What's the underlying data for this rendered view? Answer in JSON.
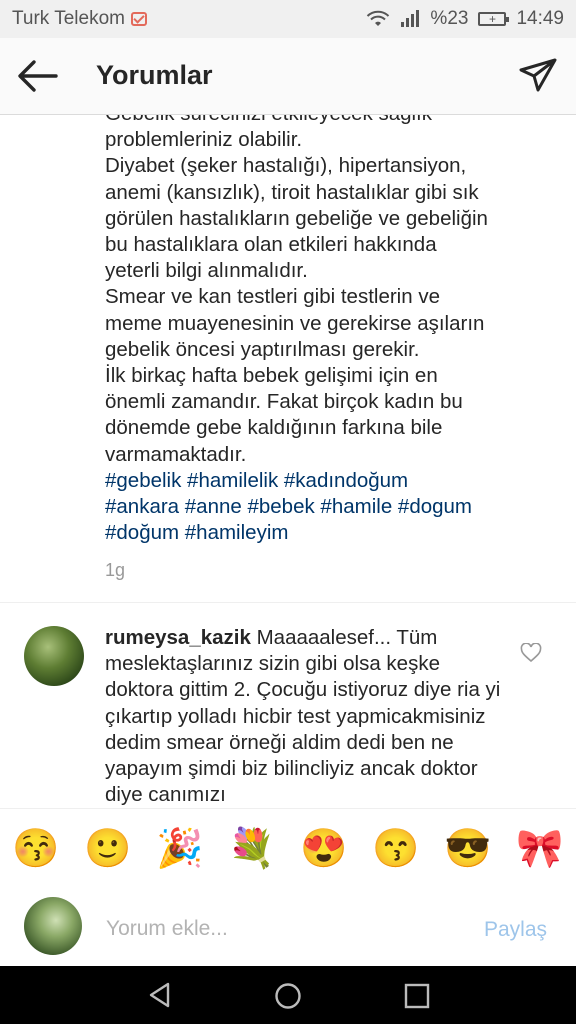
{
  "status_bar": {
    "carrier": "Turk Telekom",
    "signal_percent": "%23",
    "time": "14:49"
  },
  "header": {
    "title": "Yorumlar",
    "back_icon": "arrow-left-icon",
    "send_icon": "paper-plane-icon"
  },
  "caption": {
    "text": "Gebelik sürecinizi etkileyecek sağlık\nproblemleriniz olabilir.\nDiyabet (şeker hastalığı), hipertansiyon,\nanemi (kansızlık), tiroit hastalıklar gibi sık\ngörülen hastalıkların gebeliğe ve gebeliğin\nbu hastalıklara olan etkileri hakkında\nyeterli bilgi alınmalıdır.\nSmear ve kan testleri gibi testlerin ve\nmeme muayenesinin ve gerekirse aşıların\ngebelik öncesi yaptırılması gerekir.\nİlk birkaç hafta bebek gelişimi için en\nönemli zamandır. Fakat birçok kadın bu\ndönemde gebe kaldığının farkına bile\nvarmamaktadır.",
    "hashtags": "#gebelik #hamilelik #kadındoğum\n#ankara #anne #bebek #hamile #dogum\n#doğum #hamileyim",
    "time": "1g"
  },
  "comment": {
    "username": "rumeysa_kazik",
    "text": " Maaaaalesef... Tüm meslektaşlarınız sizin gibi olsa keşke doktora gittim 2. Çocuğu istiyoruz diye ria yi çıkartıp yolladı hicbir test yapmicakmisiniz dedim smear örneği aldim dedi  ben ne yapayım şimdi biz bilincliyiz ancak doktor diye canımızı"
  },
  "emoji_bar": [
    "😚",
    "🙂",
    "🎉",
    "💐",
    "😍",
    "😙",
    "😎",
    "🎀"
  ],
  "input": {
    "placeholder": "Yorum ekle...",
    "post_label": "Paylaş"
  },
  "colors": {
    "hashtag": "#003569",
    "post_disabled": "#9ec5ea",
    "secondary_text": "#999999"
  }
}
